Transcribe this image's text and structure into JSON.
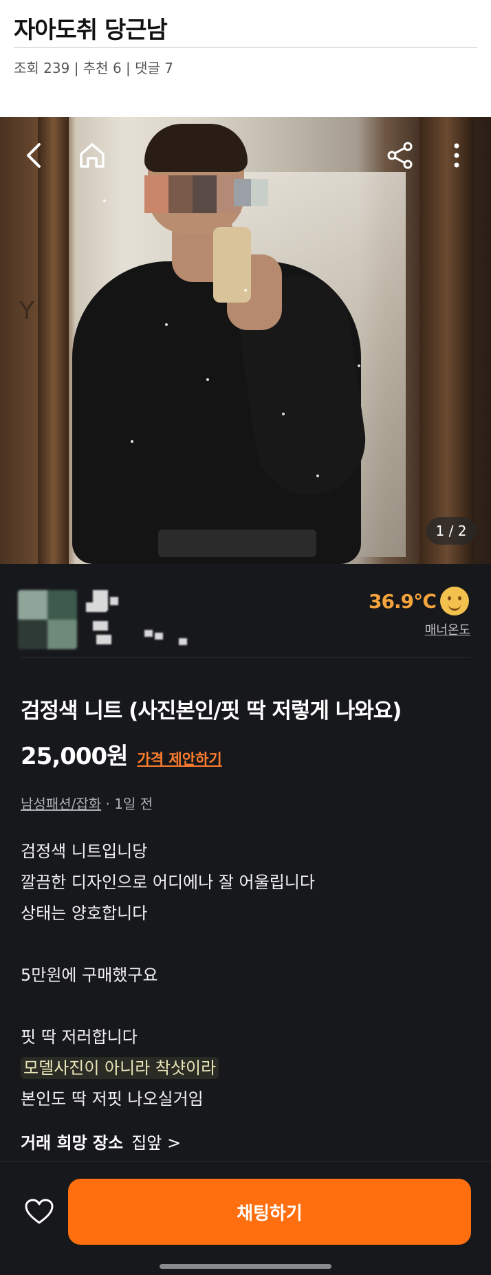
{
  "post": {
    "title": "자아도취 당근남",
    "meta": "조회 239 | 추천 6 | 댓글 7"
  },
  "photo": {
    "counter": "1 / 2",
    "icons": [
      "back-icon",
      "home-icon",
      "share-icon",
      "more-icon"
    ]
  },
  "seller": {
    "temperature": "36.9℃",
    "temperature_label": "매너온도"
  },
  "item": {
    "title": "검정색 니트 (사진본인/핏 딱 저렇게 나와요)",
    "price": "25,000원",
    "price_offer": "가격 제안하기",
    "category": "남성패션/잡화",
    "time": " · 1일 전",
    "description": [
      "검정색 니트입니당",
      "깔끔한 디자인으로 어디에나 잘 어울립니다",
      "상태는 양호합니다",
      "",
      "5만원에 구매했구요",
      "",
      "핏 딱 저러합니다",
      "모델사진이 아니라 착샷이라",
      "본인도 딱 저핏 나오실거임"
    ],
    "place_label": "거래 희망 장소",
    "place_value": "집앞 >"
  },
  "actions": {
    "chat_label": "채팅하기"
  },
  "colors": {
    "accent": "#ff6f0f",
    "background": "#17181c",
    "temperature": "#f5a33c"
  }
}
